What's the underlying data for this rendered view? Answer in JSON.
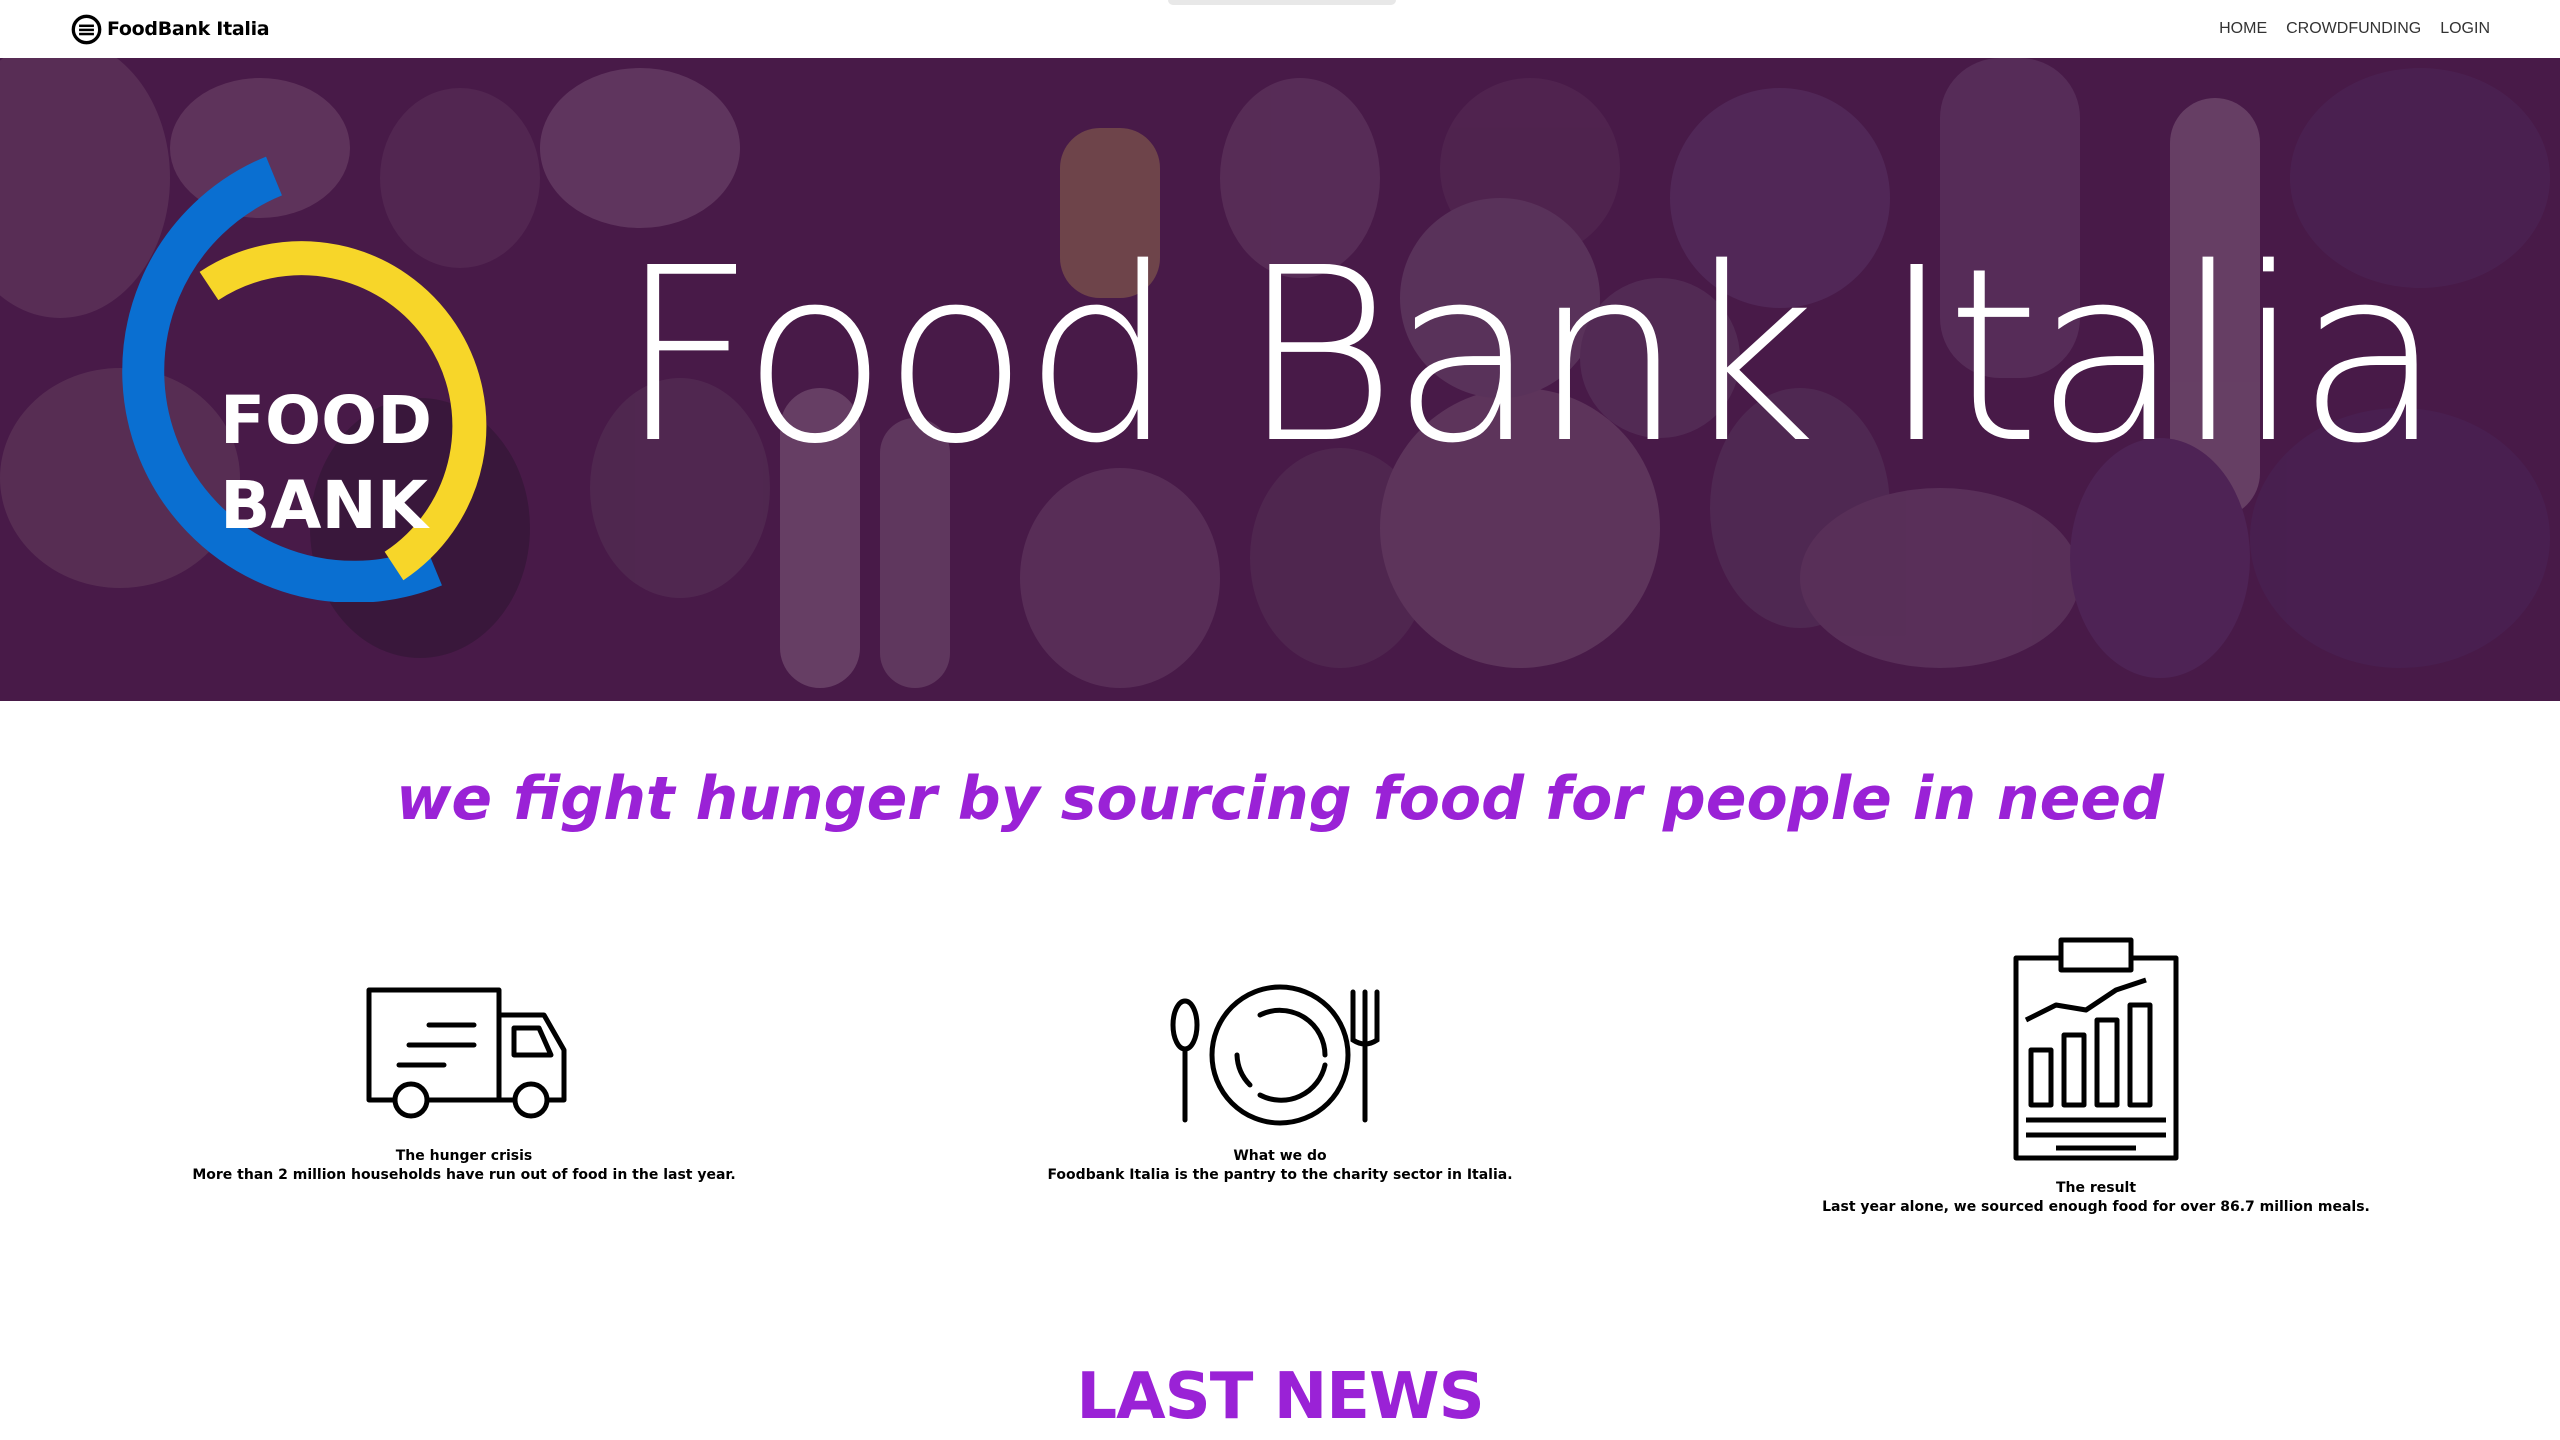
{
  "navbar": {
    "brand_text": "FoodBank Italia",
    "links": [
      "HOME",
      "CROWDFUNDING",
      "LOGIN"
    ]
  },
  "hero": {
    "title": "Food Bank Italia",
    "logo_line1": "FOOD",
    "logo_line2": "BANK"
  },
  "tagline": "we fight hunger by sourcing food for people in need",
  "features": [
    {
      "icon": "truck-icon",
      "title": "The hunger crisis",
      "text": "More than 2 million households have run out of food in the last year."
    },
    {
      "icon": "plate-cutlery-icon",
      "title": "What we do",
      "text": "Foodbank Italia is the pantry to the charity sector in Italia."
    },
    {
      "icon": "chart-clipboard-icon",
      "title": "The result",
      "text": "Last year alone, we sourced enough food for over 86.7 million meals."
    }
  ],
  "news_heading": "LAST NEWS",
  "colors": {
    "accent": "#9a22d6",
    "logo_blue": "#0a6fd1",
    "logo_yellow": "#f7d629",
    "hero_overlay": "#461446"
  }
}
